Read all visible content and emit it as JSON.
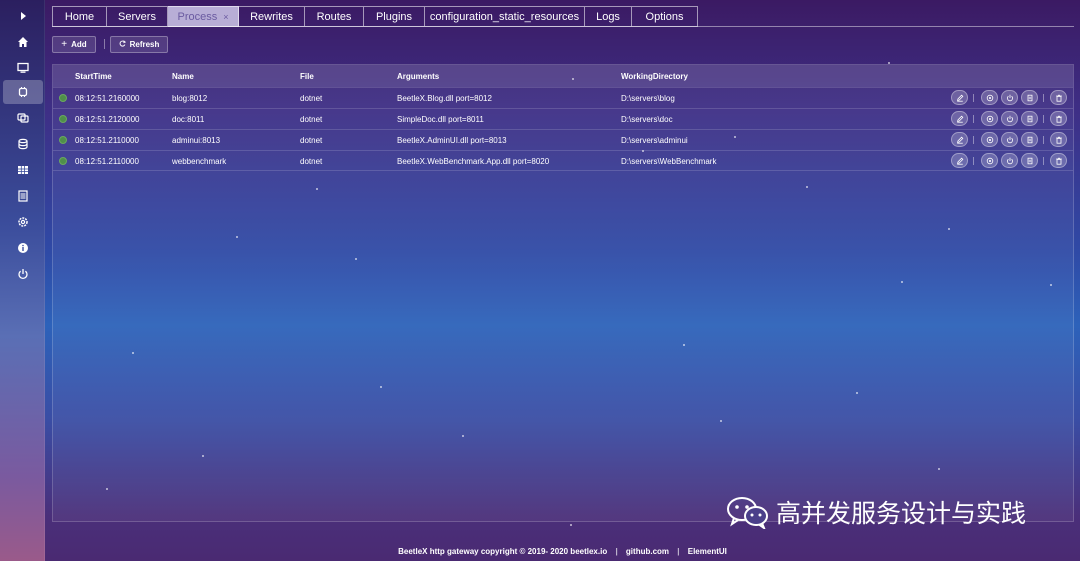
{
  "sidebar": {
    "items": [
      {
        "name": "expand-icon"
      },
      {
        "name": "home-icon"
      },
      {
        "name": "monitor-icon"
      },
      {
        "name": "process-icon",
        "active": true
      },
      {
        "name": "rewrites-icon"
      },
      {
        "name": "routes-icon"
      },
      {
        "name": "grid-icon"
      },
      {
        "name": "document-icon"
      },
      {
        "name": "settings-icon"
      },
      {
        "name": "info-icon"
      },
      {
        "name": "power-icon"
      }
    ]
  },
  "tabs": [
    {
      "label": "Home"
    },
    {
      "label": "Servers"
    },
    {
      "label": "Process",
      "active": true,
      "close": "×"
    },
    {
      "label": "Rewrites"
    },
    {
      "label": "Routes"
    },
    {
      "label": "Plugins"
    },
    {
      "label": "configuration_static_resources"
    },
    {
      "label": "Logs"
    },
    {
      "label": "Options"
    }
  ],
  "toolbar": {
    "add_label": "Add",
    "refresh_label": "Refresh"
  },
  "table": {
    "columns": [
      "StartTime",
      "Name",
      "File",
      "Arguments",
      "WorkingDirectory"
    ],
    "rows": [
      {
        "start": "08:12:51.2160000",
        "name": "blog:8012",
        "file": "dotnet",
        "args": "BeetleX.Blog.dll port=8012",
        "dir": "D:\\servers\\blog",
        "status": "running"
      },
      {
        "start": "08:12:51.2120000",
        "name": "doc:8011",
        "file": "dotnet",
        "args": "SimpleDoc.dll port=8011",
        "dir": "D:\\servers\\doc",
        "status": "running"
      },
      {
        "start": "08:12:51.2110000",
        "name": "adminui:8013",
        "file": "dotnet",
        "args": "BeetleX.AdminUI.dll port=8013",
        "dir": "D:\\servers\\adminui",
        "status": "running"
      },
      {
        "start": "08:12:51.2110000",
        "name": "webbenchmark",
        "file": "dotnet",
        "args": "BeetleX.WebBenchmark.App.dll port=8020",
        "dir": "D:\\servers\\WebBenchmark",
        "status": "running"
      }
    ],
    "actions": [
      "edit-icon",
      "view-icon",
      "power-icon",
      "log-icon",
      "delete-icon"
    ]
  },
  "footer": {
    "copyright": "BeetleX http gateway copyright © 2019- 2020 beetlex.io",
    "link1": "github.com",
    "link2": "ElementUI",
    "sep": "|"
  },
  "watermark": {
    "text": "高并发服务设计与实践"
  },
  "colors": {
    "accent": "#b8aed6",
    "status_running": "#4f8f4a"
  }
}
